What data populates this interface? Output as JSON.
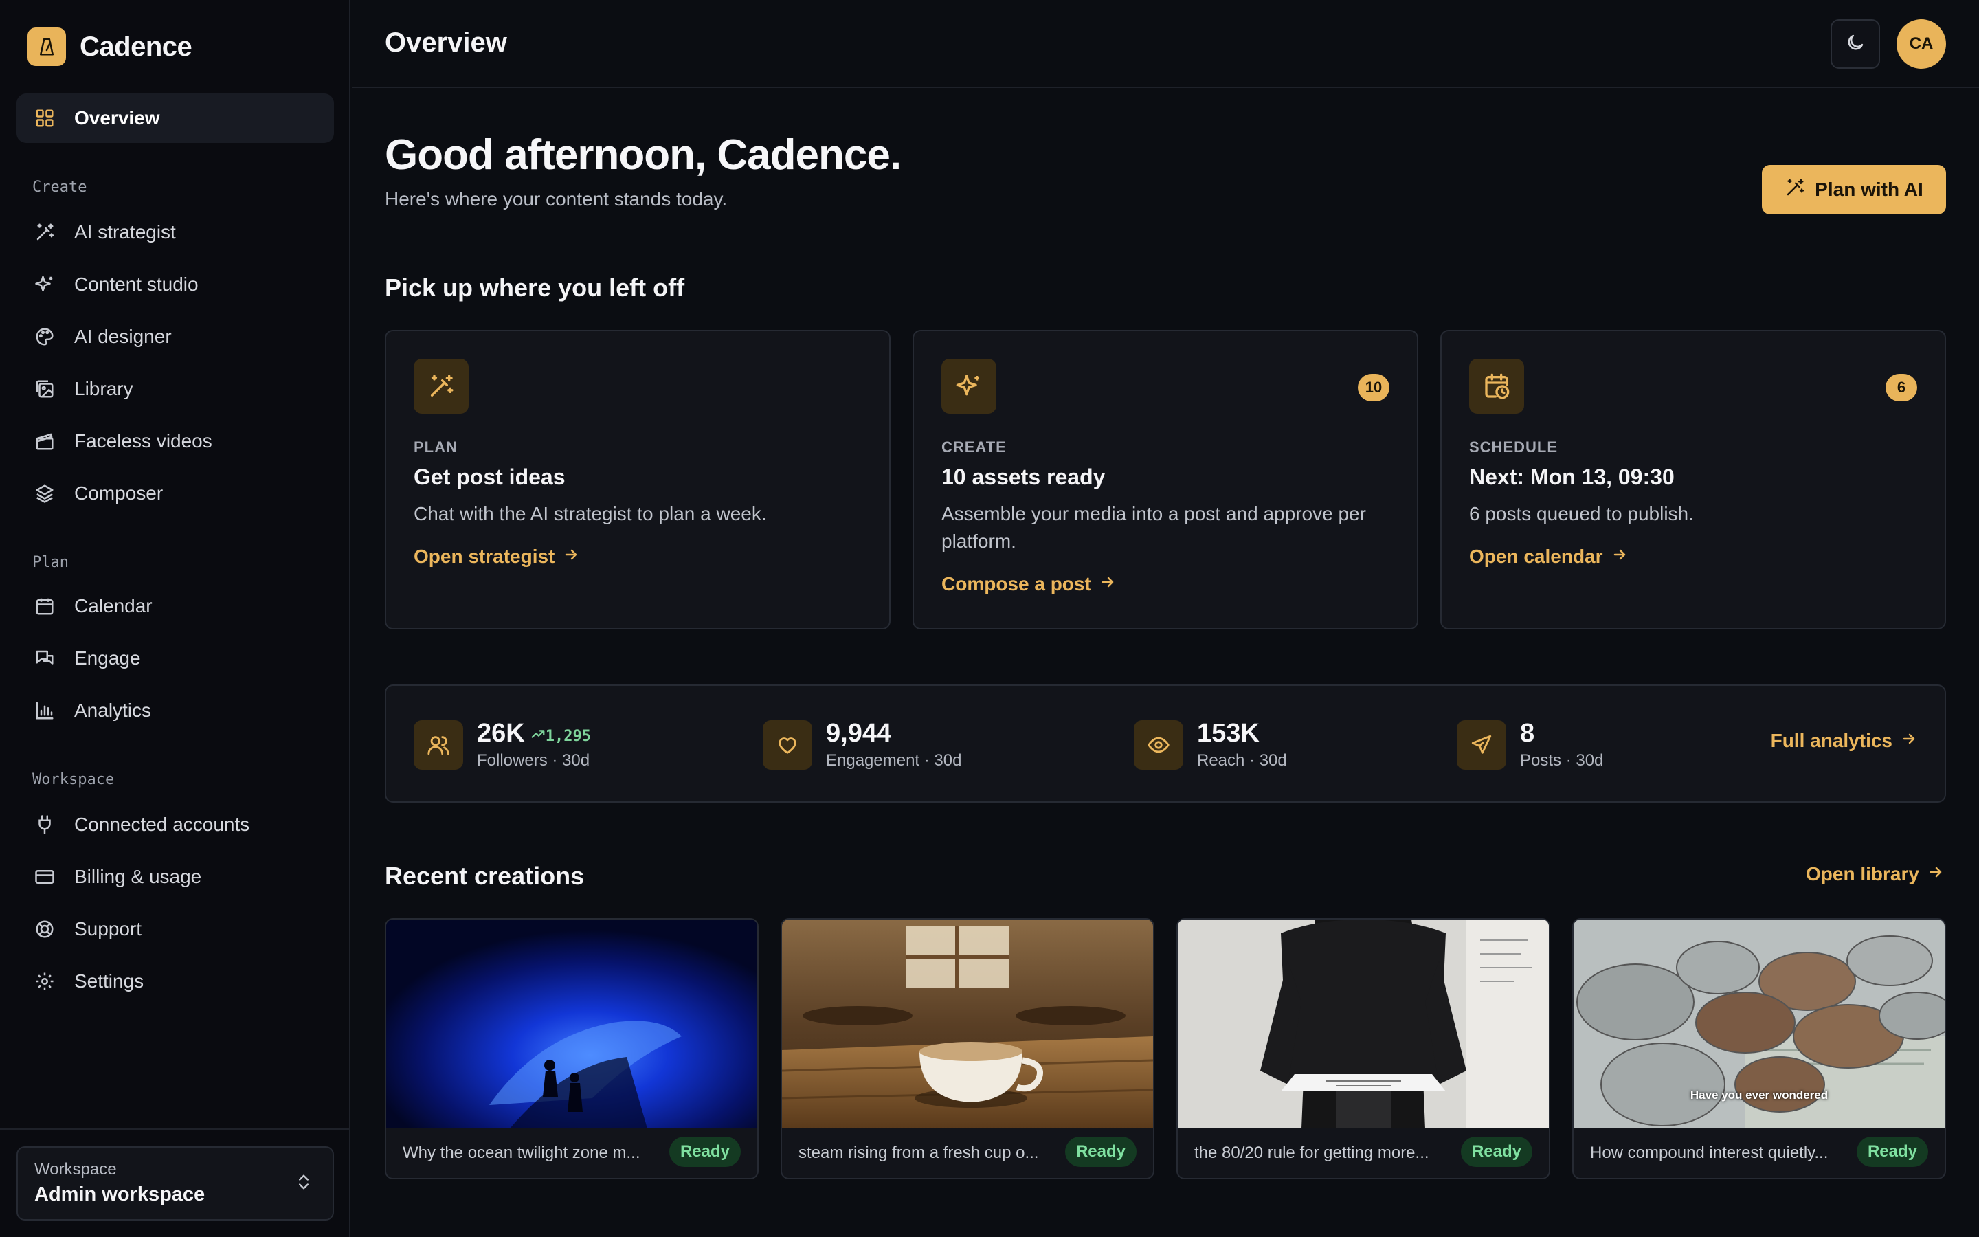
{
  "app": {
    "name": "Cadence"
  },
  "sidebar": {
    "overview": "Overview",
    "sections": {
      "create": "Create",
      "plan": "Plan",
      "workspace": "Workspace"
    },
    "create_items": [
      "AI strategist",
      "Content studio",
      "AI designer",
      "Library",
      "Faceless videos",
      "Composer"
    ],
    "plan_items": [
      "Calendar",
      "Engage",
      "Analytics"
    ],
    "workspace_items": [
      "Connected accounts",
      "Billing & usage",
      "Support",
      "Settings"
    ],
    "workspace_switcher": {
      "label": "Workspace",
      "value": "Admin workspace"
    }
  },
  "header": {
    "title": "Overview",
    "avatar_initials": "CA"
  },
  "hero": {
    "greeting": "Good afternoon, Cadence.",
    "subtitle": "Here's where your content stands today.",
    "plan_button": "Plan with AI"
  },
  "pickup": {
    "title": "Pick up where you left off",
    "cards": [
      {
        "kicker": "PLAN",
        "title": "Get post ideas",
        "desc": "Chat with the AI strategist to plan a week.",
        "link": "Open strategist",
        "badge": ""
      },
      {
        "kicker": "CREATE",
        "title": "10 assets ready",
        "desc": "Assemble your media into a post and approve per platform.",
        "link": "Compose a post",
        "badge": "10"
      },
      {
        "kicker": "SCHEDULE",
        "title": "Next: Mon 13, 09:30",
        "desc": "6 posts queued to publish.",
        "link": "Open calendar",
        "badge": "6"
      }
    ]
  },
  "stats": {
    "items": [
      {
        "value": "26K",
        "delta": "1,295",
        "label": "Followers · 30d"
      },
      {
        "value": "9,944",
        "delta": "",
        "label": "Engagement · 30d"
      },
      {
        "value": "153K",
        "delta": "",
        "label": "Reach · 30d"
      },
      {
        "value": "8",
        "delta": "",
        "label": "Posts · 30d"
      }
    ],
    "link": "Full analytics"
  },
  "recent": {
    "title": "Recent creations",
    "link": "Open library",
    "items": [
      {
        "caption": "Why the ocean twilight zone m...",
        "status": "Ready",
        "overlay": ""
      },
      {
        "caption": "steam rising from a fresh cup o...",
        "status": "Ready",
        "overlay": ""
      },
      {
        "caption": "the 80/20 rule for getting more...",
        "status": "Ready",
        "overlay": ""
      },
      {
        "caption": "How compound interest quietly...",
        "status": "Ready",
        "overlay": "Have you ever wondered"
      }
    ]
  },
  "colors": {
    "accent": "#ebb65c",
    "background": "#0b0d12",
    "success": "#7fe0a0"
  }
}
